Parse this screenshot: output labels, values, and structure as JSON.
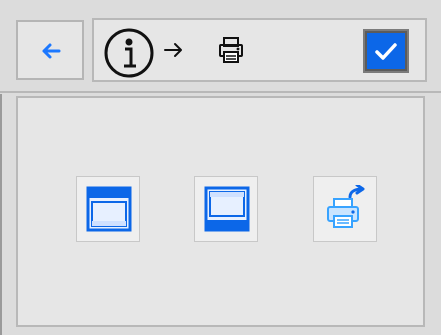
{
  "toolbar": {
    "back_icon": "back-arrow-icon",
    "info_icon": "info-icon",
    "arrow_icon": "right-arrow-icon",
    "printer_icon": "printer-icon",
    "confirm_icon": "checkmark-icon"
  },
  "main": {
    "tiles": [
      {
        "icon": "window-top-bar-icon"
      },
      {
        "icon": "window-bottom-bar-icon"
      },
      {
        "icon": "printer-share-icon"
      }
    ]
  },
  "colors": {
    "accent": "#0c67e8",
    "light_blue": "#38a3ff",
    "background": "#dcdcdc",
    "panel": "#e6e6e6"
  }
}
